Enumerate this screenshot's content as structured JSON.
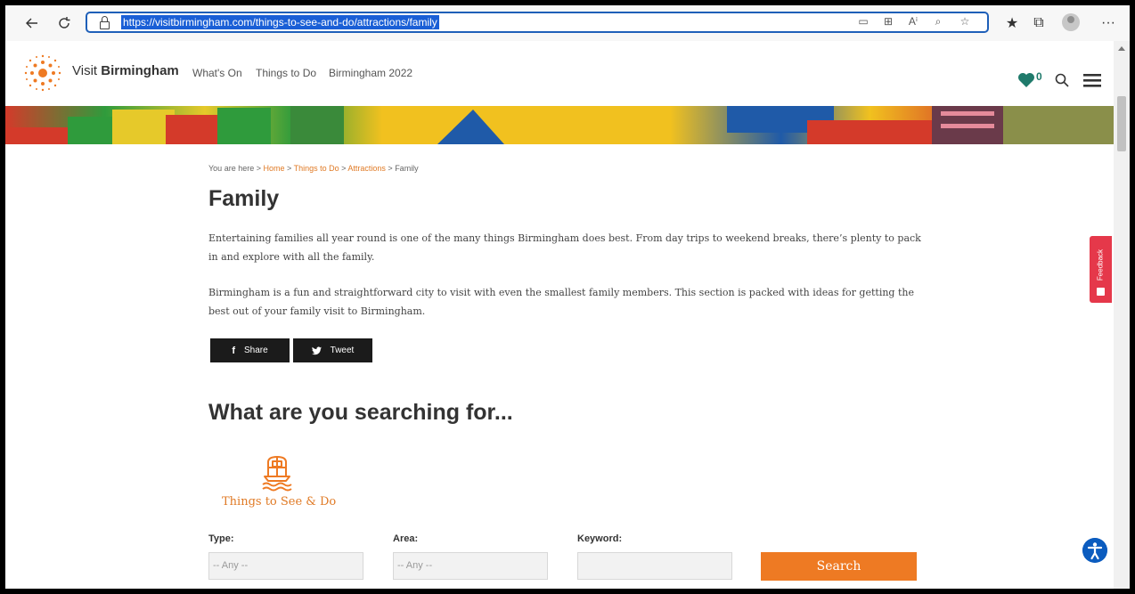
{
  "browser": {
    "url": "https://visitbirmingham.com/things-to-see-and-do/attractions/family",
    "more_label": "···"
  },
  "site": {
    "brand_prefix": "Visit ",
    "brand_name": "Birmingham",
    "nav": [
      {
        "label": "What's On"
      },
      {
        "label": "Things to Do"
      },
      {
        "label": "Birmingham 2022"
      }
    ],
    "favourites_count": "0",
    "colors": {
      "accent": "#ee7a23",
      "teal": "#1f7a6b",
      "feedback": "#e5384a"
    }
  },
  "breadcrumb": {
    "prefix": "You are here > ",
    "home": "Home",
    "things_to_do": "Things to Do",
    "attractions": "Attractions",
    "current": "Family",
    "sep": " > "
  },
  "page": {
    "title": "Family",
    "intro_1": "Entertaining families all year round is one of the many things Birmingham does best. From day trips to weekend breaks, there’s plenty to pack in and explore with all the family.",
    "intro_2": "Birmingham is a fun and straightforward city to visit with even the smallest family members. This section is packed with ideas for getting the best out of your family visit to Birmingham."
  },
  "social": {
    "share_label": "Share",
    "tweet_label": "Tweet"
  },
  "search": {
    "title": "What are you searching for...",
    "category_label": "Things to See & Do",
    "type_label": "Type:",
    "type_value": "-- Any --",
    "area_label": "Area:",
    "area_value": "-- Any --",
    "keyword_label": "Keyword:",
    "keyword_value": "",
    "button_label": "Search"
  },
  "feedback": {
    "label": "Feedback"
  }
}
